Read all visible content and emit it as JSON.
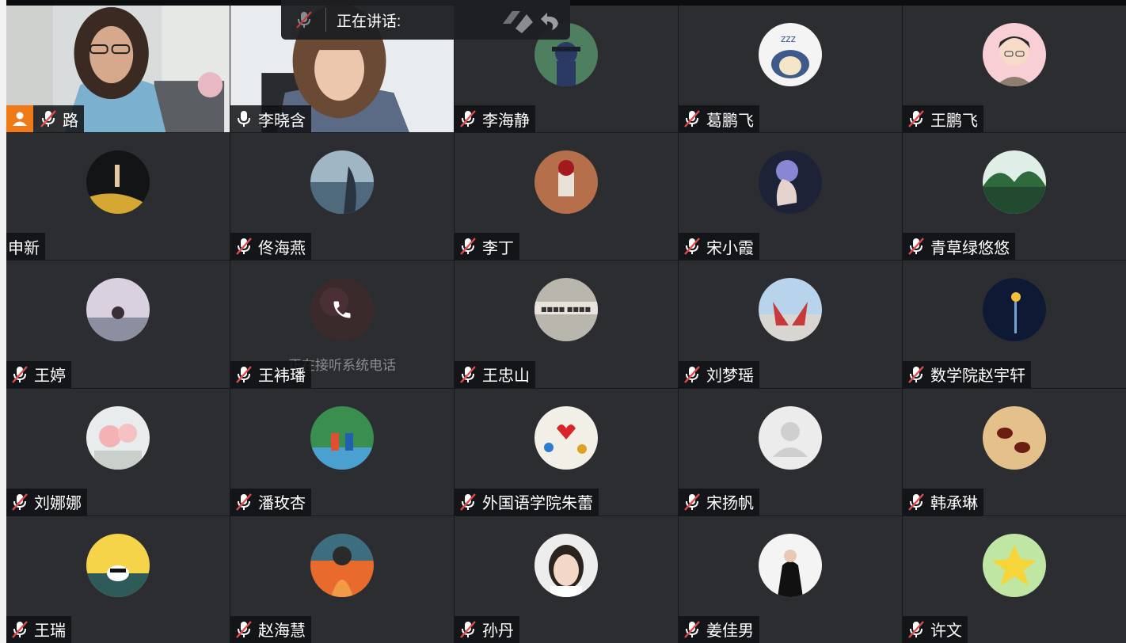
{
  "speaking_bar": {
    "label": "正在讲话:"
  },
  "status_colors": {
    "tile_bg": "#2b2d31",
    "host_badge": "#f07a18",
    "mic_off": "#e24b4b"
  },
  "participants": [
    {
      "name": "路",
      "mic": "off",
      "video": true,
      "host": true
    },
    {
      "name": "李晓含",
      "mic": "on",
      "video": true
    },
    {
      "name": "李海静",
      "mic": "off"
    },
    {
      "name": "葛鹏飞",
      "mic": "off"
    },
    {
      "name": "王鹏飞",
      "mic": "off"
    },
    {
      "name": "申新",
      "mic": "none"
    },
    {
      "name": "佟海燕",
      "mic": "off"
    },
    {
      "name": "李丁",
      "mic": "off"
    },
    {
      "name": "宋小霞",
      "mic": "off"
    },
    {
      "name": "青草绿悠悠",
      "mic": "off"
    },
    {
      "name": "王婷",
      "mic": "off"
    },
    {
      "name": "王袆璠",
      "mic": "off",
      "call_status": "正在接听系统电话"
    },
    {
      "name": "王忠山",
      "mic": "off"
    },
    {
      "name": "刘梦瑶",
      "mic": "off"
    },
    {
      "name": "数学院赵宇轩",
      "mic": "off"
    },
    {
      "name": "刘娜娜",
      "mic": "off"
    },
    {
      "name": "潘玫杏",
      "mic": "off"
    },
    {
      "name": "外国语学院朱蕾",
      "mic": "off"
    },
    {
      "name": "宋扬帆",
      "mic": "off"
    },
    {
      "name": "韩承琳",
      "mic": "off"
    },
    {
      "name": "王瑞",
      "mic": "off"
    },
    {
      "name": "赵海慧",
      "mic": "off"
    },
    {
      "name": "孙丹",
      "mic": "off"
    },
    {
      "name": "姜佳男",
      "mic": "off"
    },
    {
      "name": "许文",
      "mic": "off"
    }
  ]
}
